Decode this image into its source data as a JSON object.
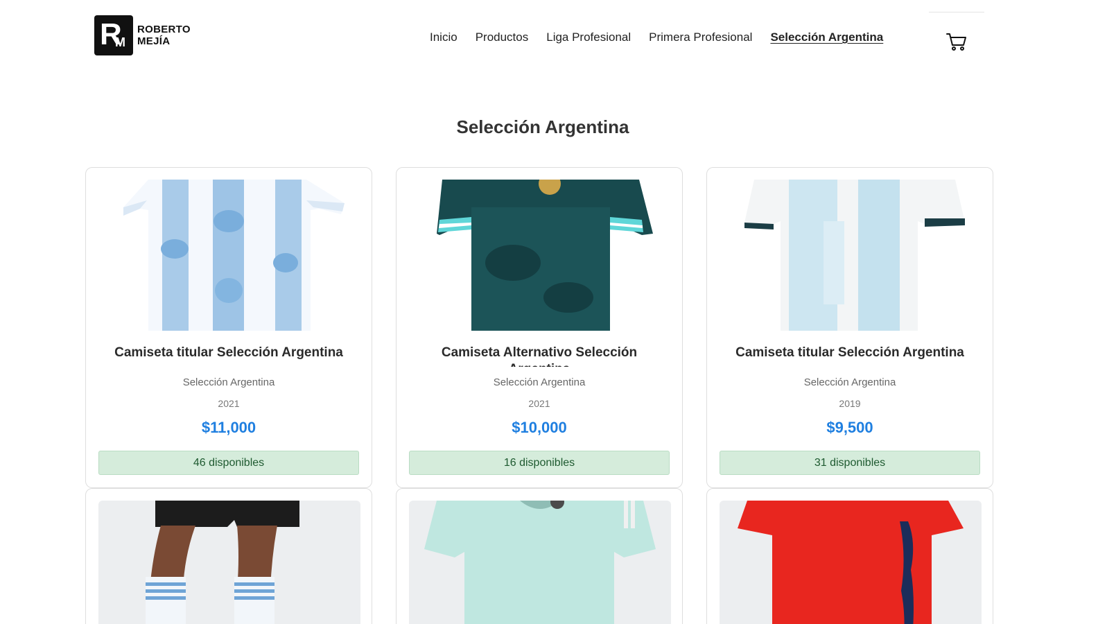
{
  "brand": {
    "line1": "ROBERTO",
    "line2": "MEJÍA",
    "mark_r": "R",
    "mark_m": "M"
  },
  "nav": {
    "items": [
      {
        "label": "Inicio",
        "active": false
      },
      {
        "label": "Productos",
        "active": false
      },
      {
        "label": "Liga Profesional",
        "active": false
      },
      {
        "label": "Primera Profesional",
        "active": false
      },
      {
        "label": "Selección Argentina",
        "active": true
      }
    ],
    "cart_icon": "cart-icon"
  },
  "page": {
    "title": "Selección Argentina"
  },
  "products": [
    {
      "title": "Camiseta titular Selección Argentina",
      "category": "Selección Argentina",
      "year": "2021",
      "price": "$11,000",
      "stock": "46 disponibles",
      "image": "jersey-white-blue-stripes"
    },
    {
      "title": "Camiseta Alternativo Selección Argentina",
      "category": "Selección Argentina",
      "year": "2021",
      "price": "$10,000",
      "stock": "16 disponibles",
      "image": "jersey-dark-teal"
    },
    {
      "title": "Camiseta titular Selección Argentina",
      "category": "Selección Argentina",
      "year": "2019",
      "price": "$9,500",
      "stock": "31 disponibles",
      "image": "jersey-white-skyblue"
    },
    {
      "image": "shorts-and-socks"
    },
    {
      "image": "jersey-mint"
    },
    {
      "image": "jersey-red"
    }
  ],
  "colors": {
    "price": "#1f7fe0",
    "stock_bg": "#d5ecdb",
    "stock_text": "#1e5a30"
  }
}
